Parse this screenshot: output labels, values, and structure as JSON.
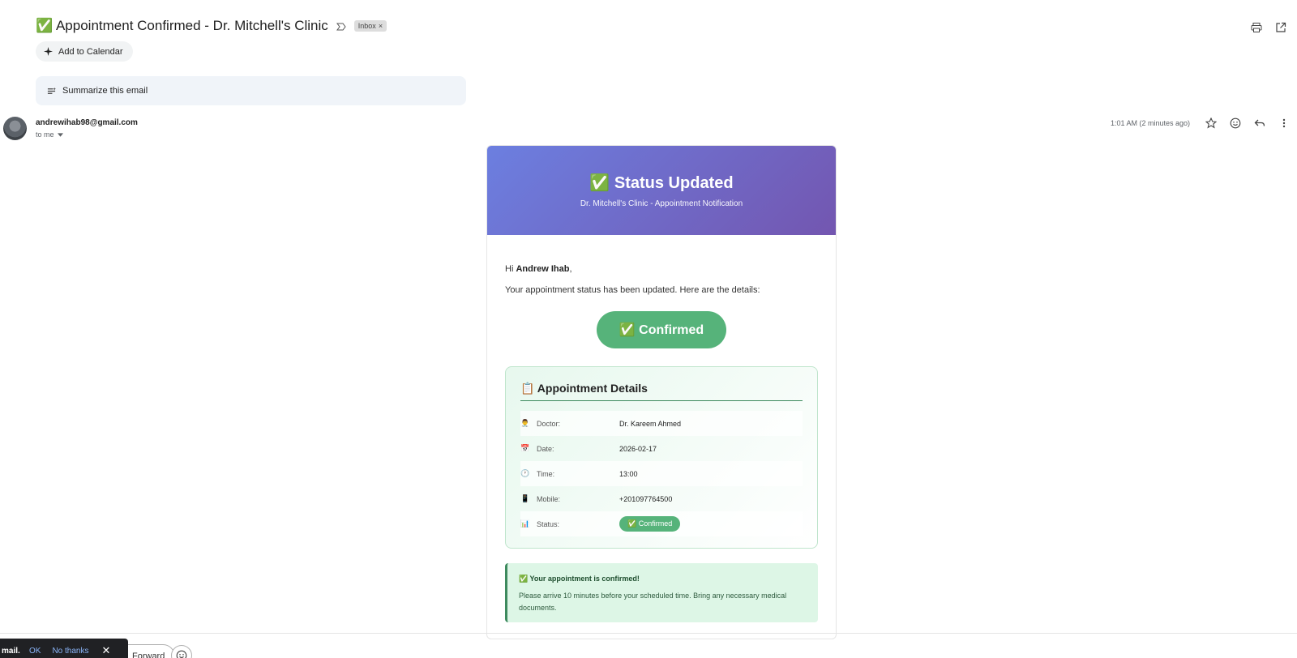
{
  "header": {
    "subject_emoji": "✅",
    "subject": "Appointment Confirmed - Dr. Mitchell's Clinic",
    "label": "Inbox",
    "add_to_calendar": "Add to Calendar",
    "summarize": "Summarize this email"
  },
  "message": {
    "sender": "andrewihab98@gmail.com",
    "to": "to me",
    "timestamp": "1:01 AM (2 minutes ago)"
  },
  "email": {
    "title": "✅ Status Updated",
    "subtitle": "Dr. Mitchell's Clinic - Appointment Notification",
    "greeting_prefix": "Hi ",
    "patient_name": "Andrew Ihab",
    "greeting_suffix": ",",
    "intro": "Your appointment status has been updated. Here are the details:",
    "status_badge": "✅ Confirmed",
    "details_title": "📋 Appointment Details",
    "details": [
      {
        "icon": "👨‍⚕️",
        "label": "Doctor:",
        "value": "Dr. Kareem Ahmed"
      },
      {
        "icon": "📅",
        "label": "Date:",
        "value": "2026-02-17"
      },
      {
        "icon": "🕐",
        "label": "Time:",
        "value": "13:00"
      },
      {
        "icon": "📱",
        "label": "Mobile:",
        "value": "+201097764500"
      },
      {
        "icon": "📊",
        "label": "Status:",
        "value": "✅ Confirmed"
      }
    ],
    "note_title": "✅ Your appointment is confirmed!",
    "note_text": "Please arrive 10 minutes before your scheduled time. Bring any necessary medical documents."
  },
  "footer": {
    "forward": "Forward",
    "snack_msg": "mail.",
    "snack_ok": "OK",
    "snack_no": "No thanks"
  },
  "colors": {
    "header_gradient_start": "#6c7fe0",
    "header_gradient_end": "#7356b0",
    "confirmed_green": "#56b37a"
  }
}
